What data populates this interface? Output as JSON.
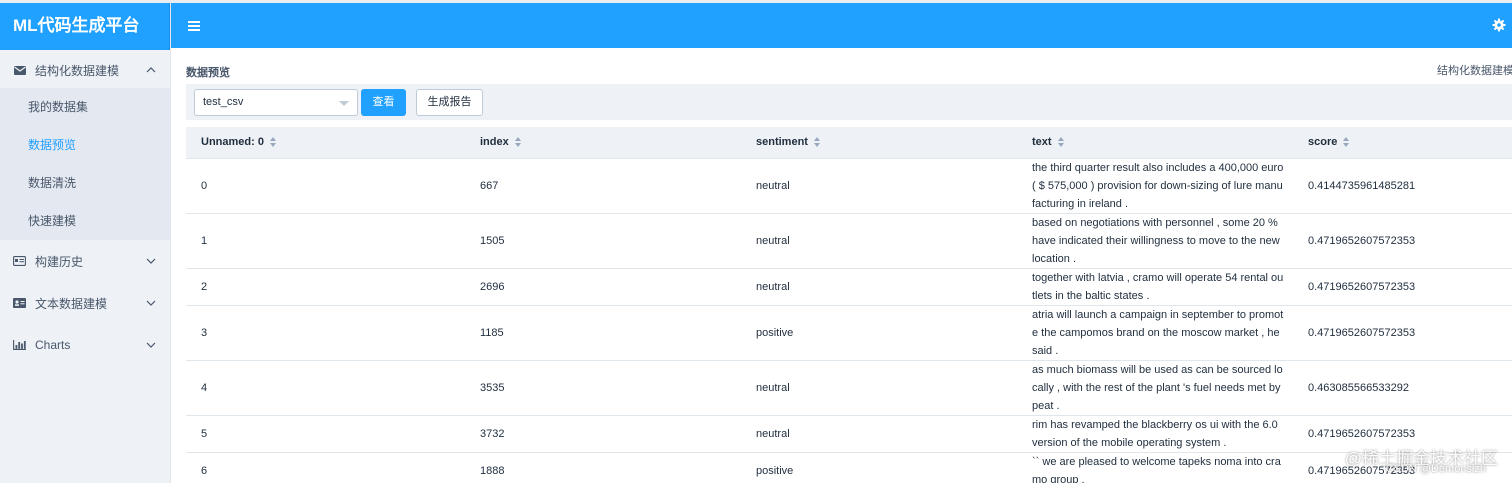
{
  "app": {
    "title": "ML代码生成平台"
  },
  "sidebar": {
    "groups": [
      {
        "label": "结构化数据建模",
        "icon": "envelope-icon",
        "expanded": true,
        "items": [
          {
            "label": "我的数据集",
            "active": false
          },
          {
            "label": "数据预览",
            "active": true
          },
          {
            "label": "数据清洗",
            "active": false
          },
          {
            "label": "快速建模",
            "active": false
          }
        ]
      },
      {
        "label": "构建历史",
        "icon": "id-card-icon",
        "expanded": false
      },
      {
        "label": "文本数据建模",
        "icon": "address-card-icon",
        "expanded": false
      },
      {
        "label": "Charts",
        "icon": "bar-chart-icon",
        "expanded": false
      }
    ]
  },
  "page": {
    "title": "数据预览",
    "breadcrumb": "结构化数据建模"
  },
  "toolbar": {
    "dataset_select": {
      "value": "test_csv"
    },
    "view_label": "查看",
    "report_label": "生成报告"
  },
  "table": {
    "columns": [
      "Unnamed: 0",
      "index",
      "sentiment",
      "text",
      "score"
    ],
    "rows": [
      [
        "0",
        "667",
        "neutral",
        "the third quarter result also includes a 400,000 euro ( $ 575,000 ) provision for down-sizing of lure manufacturing in ireland .",
        "0.4144735961485281"
      ],
      [
        "1",
        "1505",
        "neutral",
        "based on negotiations with personnel , some 20 % have indicated their willingness to move to the new location .",
        "0.4719652607572353"
      ],
      [
        "2",
        "2696",
        "neutral",
        "together with latvia , cramo will operate 54 rental outlets in the baltic states .",
        "0.4719652607572353"
      ],
      [
        "3",
        "1185",
        "positive",
        "atria will launch a campaign in september to promote the campomos brand on the moscow market , he said .",
        "0.4719652607572353"
      ],
      [
        "4",
        "3535",
        "neutral",
        "as much biomass will be used as can be sourced locally , with the rest of the plant 's fuel needs met by peat .",
        "0.463085566533292"
      ],
      [
        "5",
        "3732",
        "neutral",
        "rim has revamped the blackberry os ui with the 6.0 version of the mobile operating system .",
        "0.4719652607572353"
      ],
      [
        "6",
        "1888",
        "positive",
        "`` we are pleased to welcome tapeks noma into cramo group .",
        "0.4719652607572353"
      ]
    ]
  },
  "watermark": {
    "line1": "@稀土掘金技术社区",
    "line2": "CSDN @Demonslzh"
  },
  "colors": {
    "primary": "#20a0ff",
    "sidebar_bg": "#eef1f6",
    "submenu_bg": "#e4e8f1"
  }
}
